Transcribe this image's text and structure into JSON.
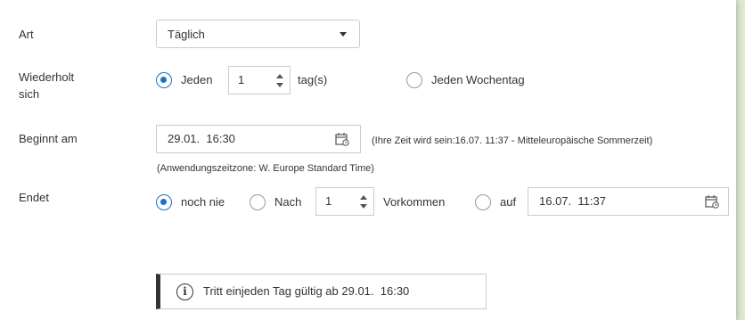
{
  "art": {
    "label": "Art",
    "selected": "Täglich"
  },
  "wiederholt": {
    "label_line1": "Wiederholt",
    "label_line2": "sich",
    "option_each": "Jeden",
    "interval": "1",
    "unit": "tag(s)",
    "option_weekday": "Jeden Wochentag"
  },
  "beginnt": {
    "label": "Beginnt am",
    "value": "29.01.  16:30",
    "user_time_note": "(Ihre Zeit wird sein:16.07.  11:37 - Mitteleuropäische Sommerzeit)",
    "timezone_note": "(Anwendungszeitzone: W. Europe Standard Time)"
  },
  "endet": {
    "label": "Endet",
    "option_never": "noch nie",
    "option_after": "Nach",
    "occurrences": "1",
    "occurrences_label": "Vorkommen",
    "option_on": "auf",
    "end_date": "16.07.  11:37"
  },
  "info": {
    "text": "Tritt einjeden Tag gültig ab 29.01.  16:30",
    "icon": "info-icon"
  },
  "colors": {
    "accent": "#1a73c8",
    "side_band": "#dfe8cf"
  }
}
